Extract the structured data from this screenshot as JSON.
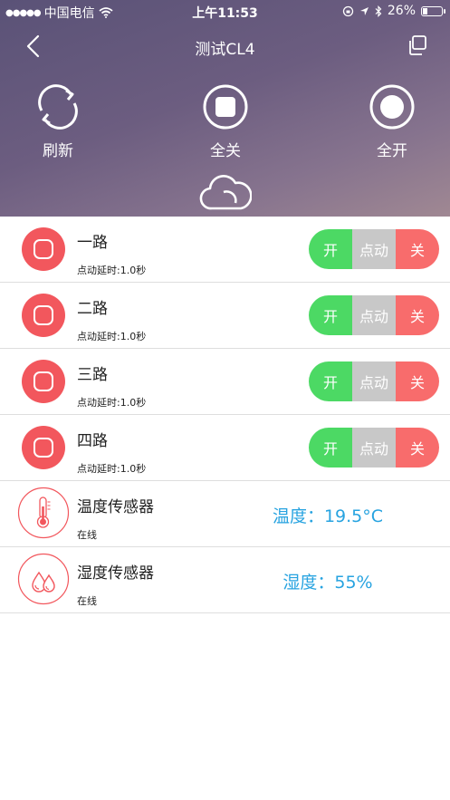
{
  "status_bar": {
    "carrier": "中国电信",
    "time": "上午11:53",
    "battery": "26%",
    "battery_level": 0.26
  },
  "nav": {
    "title": "测试CL4"
  },
  "actions": [
    {
      "label": "刷新",
      "icon": "refresh-icon"
    },
    {
      "label": "全关",
      "icon": "all-off-icon"
    },
    {
      "label": "全开",
      "icon": "all-on-icon"
    }
  ],
  "cloud_icon": "cloud-icon",
  "channels": [
    {
      "name": "一路",
      "delay": "点动延时:1.0秒"
    },
    {
      "name": "二路",
      "delay": "点动延时:1.0秒"
    },
    {
      "name": "三路",
      "delay": "点动延时:1.0秒"
    },
    {
      "name": "四路",
      "delay": "点动延时:1.0秒"
    }
  ],
  "controls": {
    "on": "开",
    "pulse": "点动",
    "off": "关"
  },
  "sensors": [
    {
      "name": "温度传感器",
      "status": "在线",
      "reading": "温度：19.5°C",
      "icon": "thermometer-icon"
    },
    {
      "name": "湿度传感器",
      "status": "在线",
      "reading": "湿度：55%",
      "icon": "water-drops-icon"
    }
  ],
  "colors": {
    "accent_red": "#f2575d",
    "on_green": "#4cd964",
    "pulse_gray": "#c8c8c8",
    "off_red": "#f86c6c",
    "reading_blue": "#27a3e0"
  }
}
